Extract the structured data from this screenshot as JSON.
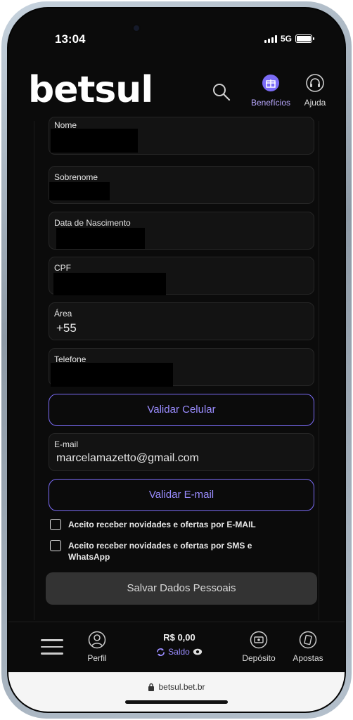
{
  "status": {
    "time": "13:04",
    "network": "5G"
  },
  "header": {
    "logo": "betsul",
    "benefits_label": "Benefícios",
    "help_label": "Ajuda"
  },
  "form": {
    "fields": [
      {
        "label": "Nome",
        "value": ""
      },
      {
        "label": "Sobrenome",
        "value": ""
      },
      {
        "label": "Data de Nascimento",
        "value": ""
      },
      {
        "label": "CPF",
        "value": ""
      },
      {
        "label": "Área",
        "value": "+55"
      },
      {
        "label": "Telefone",
        "value": ""
      }
    ],
    "validate_phone": "Validar Celular",
    "email": {
      "label": "E-mail",
      "value": "marcelamazetto@gmail.com"
    },
    "validate_email": "Validar E-mail",
    "opt_email": "Aceito receber novidades e ofertas por E-MAIL",
    "opt_sms": "Aceito receber novidades e ofertas por SMS e WhatsApp",
    "save": "Salvar Dados Pessoais"
  },
  "bottom_nav": {
    "profile": "Perfil",
    "balance": "R$ 0,00",
    "balance_label": "Saldo",
    "deposit": "Depósito",
    "bets": "Apostas"
  },
  "browser": {
    "url": "betsul.bet.br"
  },
  "colors": {
    "accent": "#7b6cf6",
    "background": "#0b0b0b",
    "field": "#131313"
  }
}
